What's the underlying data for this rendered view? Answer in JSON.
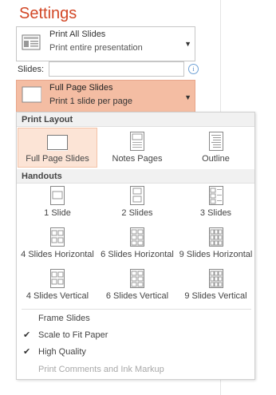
{
  "title": "Settings",
  "print_what": {
    "line1": "Print All Slides",
    "line2": "Print entire presentation"
  },
  "slides": {
    "label": "Slides:",
    "value": "",
    "info_icon": "i"
  },
  "layout_dd": {
    "line1": "Full Page Slides",
    "line2": "Print 1 slide per page"
  },
  "menu": {
    "print_layout": {
      "header": "Print Layout",
      "items": [
        {
          "label": "Full Page Slides",
          "icon": "full-page-slides-icon",
          "selected": true
        },
        {
          "label": "Notes Pages",
          "icon": "notes-pages-icon"
        },
        {
          "label": "Outline",
          "icon": "outline-icon"
        }
      ]
    },
    "handouts": {
      "header": "Handouts",
      "items": [
        {
          "label": "1 Slide",
          "icon": "handout-1-slide-icon"
        },
        {
          "label": "2 Slides",
          "icon": "handout-2-slides-icon"
        },
        {
          "label": "3 Slides",
          "icon": "handout-3-slides-icon"
        },
        {
          "label": "4 Slides Horizontal",
          "icon": "handout-4-horizontal-icon"
        },
        {
          "label": "6 Slides Horizontal",
          "icon": "handout-6-horizontal-icon"
        },
        {
          "label": "9 Slides Horizontal",
          "icon": "handout-9-horizontal-icon"
        },
        {
          "label": "4 Slides Vertical",
          "icon": "handout-4-vertical-icon"
        },
        {
          "label": "6 Slides Vertical",
          "icon": "handout-6-vertical-icon"
        },
        {
          "label": "9 Slides Vertical",
          "icon": "handout-9-vertical-icon"
        }
      ]
    },
    "options": [
      {
        "label": "Frame Slides",
        "checked": false,
        "enabled": true
      },
      {
        "label": "Scale to Fit Paper",
        "checked": true,
        "enabled": true
      },
      {
        "label": "High Quality",
        "checked": true,
        "enabled": true
      },
      {
        "label": "Print Comments and Ink Markup",
        "checked": false,
        "enabled": false
      }
    ],
    "check_glyph": "✔"
  },
  "colors": {
    "accent": "#d24726",
    "selected_bg": "#fce4d6",
    "dropdown_highlight": "#f4bda3"
  }
}
